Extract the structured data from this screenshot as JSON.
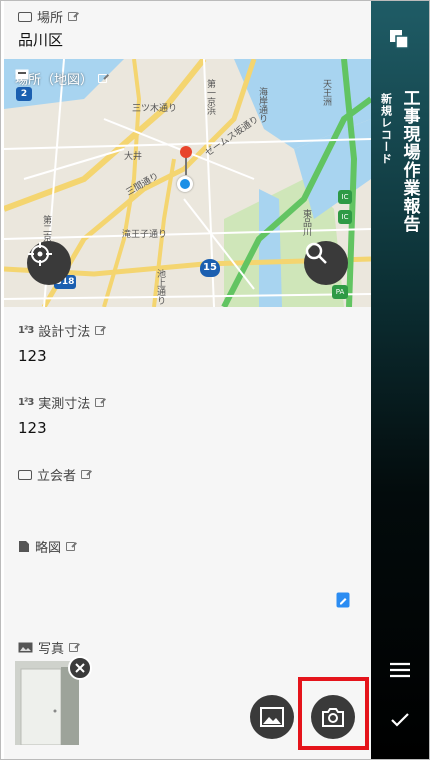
{
  "fields": {
    "location": {
      "label": "場所",
      "value": "品川区"
    },
    "map": {
      "label": "場所（地図）"
    },
    "design_dim": {
      "label": "設計寸法",
      "value": "123"
    },
    "measured_dim": {
      "label": "実測寸法",
      "value": "123"
    },
    "attendee": {
      "label": "立会者",
      "value": ""
    },
    "sketch": {
      "label": "略図"
    },
    "photo": {
      "label": "写真"
    }
  },
  "map_text": {
    "shield_2": "2",
    "shield_15": "15",
    "shield_318": "318",
    "ic1": "IC",
    "ic2": "IC",
    "pa": "PA",
    "streets": [
      "三ツ木通り",
      "第二京浜",
      "三間通り",
      "ゼームス坂通り",
      "第一京浜",
      "海岸通り",
      "池上通り",
      "滝王子通り",
      "大井",
      "天王洲",
      "東品川"
    ]
  },
  "panel": {
    "title": "工事現場作業報告",
    "subtitle": "新規レコード"
  },
  "colors": {
    "panel_top": "#1f5c66",
    "panel_bottom": "#000000",
    "highlight": "#e5141b",
    "map_pin": "#e8452c",
    "location_dot": "#1a8fe6"
  },
  "icons": [
    "layers-icon",
    "menu-icon",
    "check-icon",
    "crosshair-icon",
    "search-icon",
    "image-icon",
    "camera-icon",
    "close-icon",
    "sketch-edit-icon"
  ]
}
